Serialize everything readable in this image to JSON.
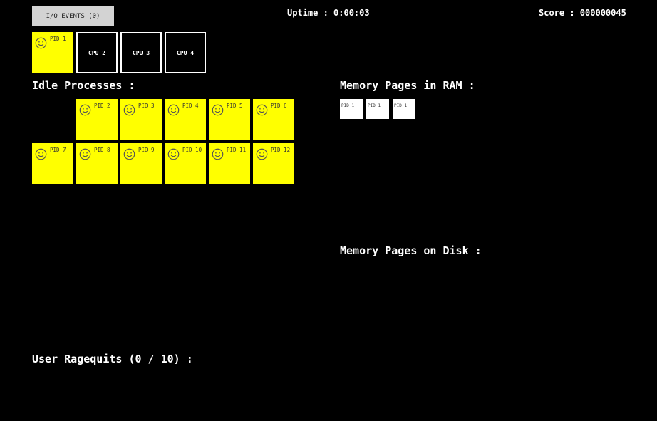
{
  "io_events_button": "I/O EVENTS (0)",
  "uptime": "Uptime : 0:00:03",
  "score": "Score : 000000045",
  "cpus": [
    {
      "label": "",
      "process": "PID 1"
    },
    {
      "label": "CPU 2"
    },
    {
      "label": "CPU 3"
    },
    {
      "label": "CPU 4"
    }
  ],
  "idle_title": "Idle Processes :",
  "idle_processes": [
    "PID 2",
    "PID 3",
    "PID 4",
    "PID 5",
    "PID 6",
    "PID 7",
    "PID 8",
    "PID 9",
    "PID 10",
    "PID 11",
    "PID 12"
  ],
  "ram_title": "Memory Pages in RAM :",
  "ram_pages": [
    "PID 1",
    "PID 1",
    "PID 1"
  ],
  "disk_title": "Memory Pages on Disk :",
  "ragequits": "User Ragequits (0 / 10) :",
  "colors": {
    "process": "#ffff00",
    "background": "#000000",
    "page": "#ffffff",
    "button": "#d3d3d3"
  },
  "icons": {
    "process": "smiley-face-icon"
  }
}
